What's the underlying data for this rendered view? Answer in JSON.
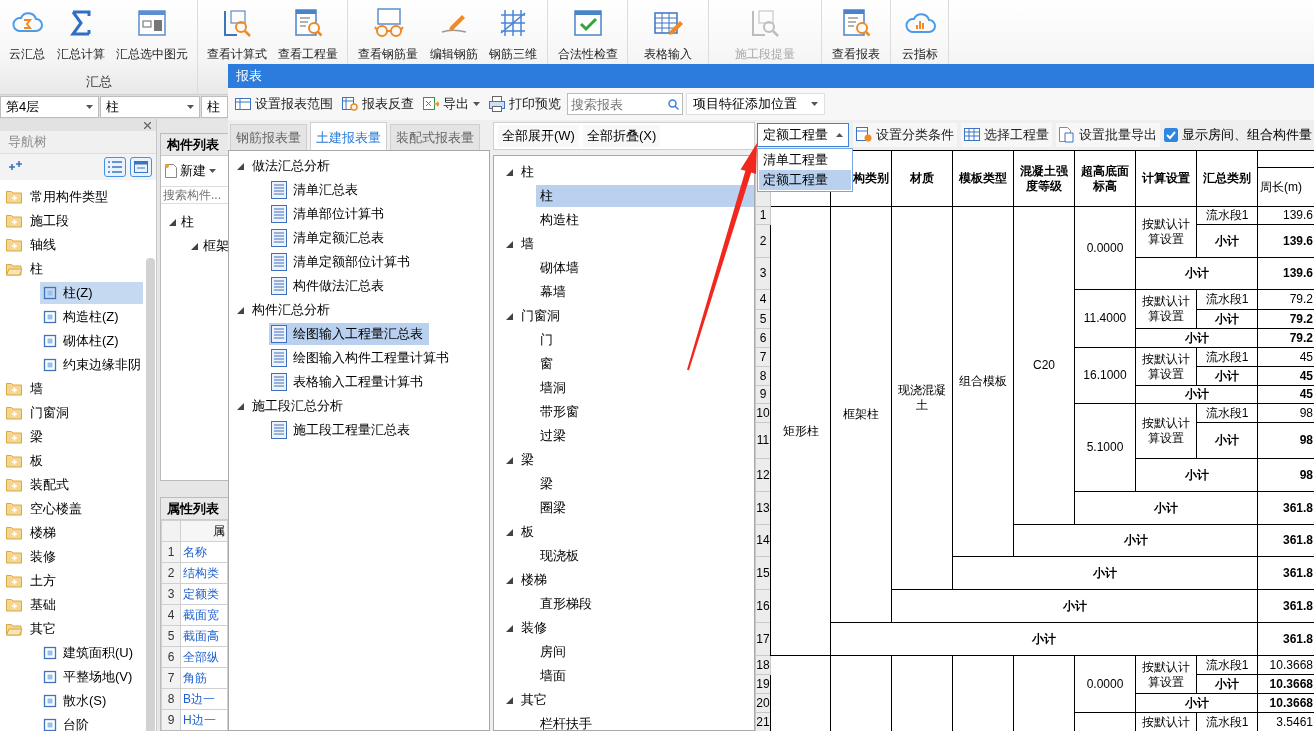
{
  "ribbon": {
    "groups": [
      {
        "label": "汇总",
        "buttons": [
          {
            "label": "云汇总",
            "disabled": false
          },
          {
            "label": "汇总计算",
            "disabled": false
          },
          {
            "label": "汇总选中图元",
            "disabled": false
          }
        ]
      },
      {
        "buttons": [
          {
            "label": "查看计算式",
            "disabled": false
          },
          {
            "label": "查看工程量",
            "disabled": false
          }
        ]
      },
      {
        "buttons": [
          {
            "label": "查看钢筋量",
            "disabled": false
          },
          {
            "label": "编辑钢筋",
            "disabled": false
          },
          {
            "label": "钢筋三维",
            "disabled": false
          }
        ]
      },
      {
        "buttons": [
          {
            "label": "合法性检查",
            "disabled": false
          }
        ]
      },
      {
        "buttons": [
          {
            "label": "表格输入",
            "disabled": false
          }
        ]
      },
      {
        "buttons": [
          {
            "label": "施工段提量",
            "disabled": true
          }
        ]
      },
      {
        "buttons": [
          {
            "label": "查看报表",
            "disabled": false
          }
        ]
      },
      {
        "buttons": [
          {
            "label": "云指标",
            "disabled": false
          }
        ]
      }
    ]
  },
  "floor_bar": {
    "floor": "第4层",
    "category": "柱",
    "component": "柱"
  },
  "nav_tree": {
    "title": "导航树",
    "items": [
      {
        "label": "常用构件类型",
        "expanded": false
      },
      {
        "label": "施工段",
        "expanded": false
      },
      {
        "label": "轴线",
        "expanded": false
      },
      {
        "label": "柱",
        "expanded": true,
        "children": [
          {
            "label": "柱(Z)",
            "selected": true
          },
          {
            "label": "构造柱(Z)",
            "selected": false
          },
          {
            "label": "砌体柱(Z)",
            "selected": false
          },
          {
            "label": "约束边缘非阴",
            "selected": false
          }
        ]
      },
      {
        "label": "墙",
        "expanded": false
      },
      {
        "label": "门窗洞",
        "expanded": false
      },
      {
        "label": "梁",
        "expanded": false
      },
      {
        "label": "板",
        "expanded": false
      },
      {
        "label": "装配式",
        "expanded": false
      },
      {
        "label": "空心楼盖",
        "expanded": false
      },
      {
        "label": "楼梯",
        "expanded": false
      },
      {
        "label": "装修",
        "expanded": false
      },
      {
        "label": "土方",
        "expanded": false
      },
      {
        "label": "基础",
        "expanded": false
      },
      {
        "label": "其它",
        "expanded": true,
        "children": [
          {
            "label": "建筑面积(U)",
            "selected": false
          },
          {
            "label": "平整场地(V)",
            "selected": false
          },
          {
            "label": "散水(S)",
            "selected": false
          },
          {
            "label": "台阶",
            "selected": false
          }
        ]
      }
    ]
  },
  "component_list": {
    "title": "构件列表",
    "new_button": "新建",
    "search": {
      "placeholder": "搜索构件..."
    },
    "tree": [
      {
        "label": "柱",
        "children": [
          {
            "label": "框架"
          }
        ]
      }
    ]
  },
  "properties": {
    "title": "属性列表",
    "column": "属",
    "rows": [
      {
        "index": "1",
        "name": "名称"
      },
      {
        "index": "2",
        "name": "结构类"
      },
      {
        "index": "3",
        "name": "定额类"
      },
      {
        "index": "4",
        "name": "截面宽"
      },
      {
        "index": "5",
        "name": "截面高"
      },
      {
        "index": "6",
        "name": "全部纵"
      },
      {
        "index": "7",
        "name": "角筋"
      },
      {
        "index": "8",
        "name": "B边一"
      },
      {
        "index": "9",
        "name": "H边一"
      }
    ]
  },
  "report": {
    "title": "报表",
    "toolbar": [
      {
        "label": "设置报表范围",
        "menu": false
      },
      {
        "label": "报表反查",
        "menu": false
      },
      {
        "label": "导出",
        "menu": true
      },
      {
        "label": "打印预览",
        "menu": false
      }
    ],
    "search": {
      "placeholder": "搜索报表"
    },
    "position_dropdown": "项目特征添加位置",
    "tabs": [
      {
        "label": "钢筋报表量",
        "selected": false
      },
      {
        "label": "土建报表量",
        "selected": true
      },
      {
        "label": "装配式报表量",
        "selected": false
      }
    ],
    "report_tree": [
      {
        "label": "做法汇总分析",
        "expanded": true,
        "children": [
          {
            "label": "清单汇总表",
            "selected": false
          },
          {
            "label": "清单部位计算书",
            "selected": false
          },
          {
            "label": "清单定额汇总表",
            "selected": false
          },
          {
            "label": "清单定额部位计算书",
            "selected": false
          },
          {
            "label": "构件做法汇总表",
            "selected": false
          }
        ]
      },
      {
        "label": "构件汇总分析",
        "expanded": true,
        "children": [
          {
            "label": "绘图输入工程量汇总表",
            "selected": true
          },
          {
            "label": "绘图输入构件工程量计算书",
            "selected": false
          },
          {
            "label": "表格输入工程量计算书",
            "selected": false
          }
        ]
      },
      {
        "label": "施工段汇总分析",
        "expanded": true,
        "children": [
          {
            "label": "施工段工程量汇总表",
            "selected": false
          }
        ]
      }
    ],
    "expand_all": "全部展开(W)",
    "collapse_all": "全部折叠(X)",
    "category_tree": [
      {
        "label": "柱",
        "expanded": true,
        "children": [
          {
            "label": "柱",
            "selected": true
          },
          {
            "label": "构造柱",
            "selected": false
          }
        ]
      },
      {
        "label": "墙",
        "expanded": true,
        "children": [
          {
            "label": "砌体墙",
            "selected": false
          },
          {
            "label": "幕墙",
            "selected": false
          }
        ]
      },
      {
        "label": "门窗洞",
        "expanded": true,
        "children": [
          {
            "label": "门",
            "selected": false
          },
          {
            "label": "窗",
            "selected": false
          },
          {
            "label": "墙洞",
            "selected": false
          },
          {
            "label": "带形窗",
            "selected": false
          },
          {
            "label": "过梁",
            "selected": false
          }
        ]
      },
      {
        "label": "梁",
        "expanded": true,
        "children": [
          {
            "label": "梁",
            "selected": false
          },
          {
            "label": "圈梁",
            "selected": false
          }
        ]
      },
      {
        "label": "板",
        "expanded": true,
        "children": [
          {
            "label": "现浇板",
            "selected": false
          }
        ]
      },
      {
        "label": "楼梯",
        "expanded": true,
        "children": [
          {
            "label": "直形梯段",
            "selected": false
          }
        ]
      },
      {
        "label": "装修",
        "expanded": true,
        "children": [
          {
            "label": "房间",
            "selected": false
          },
          {
            "label": "墙面",
            "selected": false
          }
        ]
      },
      {
        "label": "其它",
        "expanded": true,
        "children": [
          {
            "label": "栏杆扶手",
            "selected": false
          }
        ]
      }
    ],
    "quantity_dropdown": {
      "value": "定额工程量",
      "expanded": true,
      "options": [
        {
          "label": "清单工程量",
          "selected": false
        },
        {
          "label": "定额工程量",
          "selected": true
        }
      ]
    },
    "table_toolbar": [
      {
        "label": "设置分类条件"
      },
      {
        "label": "选择工程量"
      },
      {
        "label": "设置批量导出"
      }
    ],
    "show_rooms": {
      "label": "显示房间、组合构件量",
      "checked": true
    },
    "table": {
      "columns": [
        {
          "label": "构类别"
        },
        {
          "label": "材质"
        },
        {
          "label": "模板类型"
        },
        {
          "label": "混凝土强度等级"
        },
        {
          "label": "超高底面标高"
        },
        {
          "label": "计算设置"
        },
        {
          "label": "汇总类别"
        },
        {
          "children": [
            {
              "label": "周长(m)"
            }
          ]
        }
      ],
      "row_numbers": [
        "1",
        "2",
        "3",
        "4",
        "5",
        "6",
        "7",
        "8",
        "9",
        "10",
        "11",
        "12",
        "13",
        "14",
        "15",
        "16",
        "17",
        "18",
        "19",
        "20",
        "21"
      ],
      "groups": [
        {
          "text": "矩形柱",
          "subtotal": {
            "label": "小计",
            "value": "361.8"
          },
          "children": [
            {
              "text": "框架柱",
              "subtotal": {
                "label": "小计",
                "value": "361.8"
              },
              "children": [
                {
                  "text": "现浇混凝土",
                  "subtotal": {
                    "label": "小计",
                    "value": "361.8"
                  },
                  "children": [
                    {
                      "text": "组合模板",
                      "subtotal": {
                        "label": "小计",
                        "value": "361.8"
                      },
                      "children": [
                        {
                          "text": "C20",
                          "subtotal": {
                            "label": "小计",
                            "value": "361.8"
                          },
                          "children": [
                            {
                              "text": "0.0000",
                              "subtotal": {
                                "label": "小计",
                                "value": "139.6"
                              },
                              "children": [
                                {
                                  "text": "按默认计算设置",
                                  "subtotal": {
                                    "label": "小计",
                                    "value": "139.6"
                                  },
                                  "children": [
                                    {
                                      "text": "流水段1",
                                      "value": "139.6"
                                    }
                                  ]
                                }
                              ]
                            },
                            {
                              "text": "11.4000",
                              "subtotal": {
                                "label": "小计",
                                "value": "79.2"
                              },
                              "children": [
                                {
                                  "text": "按默认计算设置",
                                  "subtotal": {
                                    "label": "小计",
                                    "value": "79.2"
                                  },
                                  "children": [
                                    {
                                      "text": "流水段1",
                                      "value": "79.2"
                                    }
                                  ]
                                }
                              ]
                            },
                            {
                              "text": "16.1000",
                              "subtotal": {
                                "label": "小计",
                                "value": "45"
                              },
                              "children": [
                                {
                                  "text": "按默认计算设置",
                                  "subtotal": {
                                    "label": "小计",
                                    "value": "45"
                                  },
                                  "children": [
                                    {
                                      "text": "流水段1",
                                      "value": "45"
                                    }
                                  ]
                                }
                              ]
                            },
                            {
                              "text": "5.1000",
                              "subtotal": {
                                "label": "小计",
                                "value": "98"
                              },
                              "children": [
                                {
                                  "text": "按默认计算设置",
                                  "subtotal": {
                                    "label": "小计",
                                    "value": "98"
                                  },
                                  "children": [
                                    {
                                      "text": "流水段1",
                                      "value": "98"
                                    }
                                  ]
                                }
                              ]
                            }
                          ]
                        }
                      ]
                    }
                  ]
                }
              ]
            }
          ]
        },
        {
          "children": [
            {
              "children": [
                {
                  "children": [
                    {
                      "children": [
                        {
                          "children": [
                            {
                              "text": "0.0000",
                              "subtotal": {
                                "label": "小计",
                                "value": "10.3668"
                              },
                              "children": [
                                {
                                  "text": "按默认计算设置",
                                  "subtotal": {
                                    "label": "小计",
                                    "value": "10.3668"
                                  },
                                  "children": [
                                    {
                                      "text": "流水段1",
                                      "value": "10.3668"
                                    }
                                  ]
                                }
                              ]
                            },
                            {
                              "children": [
                                {
                                  "text": "按默认计",
                                  "children": [
                                    {
                                      "text": "流水段1",
                                      "value": "3.5461"
                                    }
                                  ]
                                }
                              ]
                            }
                          ]
                        }
                      ]
                    }
                  ]
                }
              ]
            }
          ]
        }
      ]
    }
  }
}
